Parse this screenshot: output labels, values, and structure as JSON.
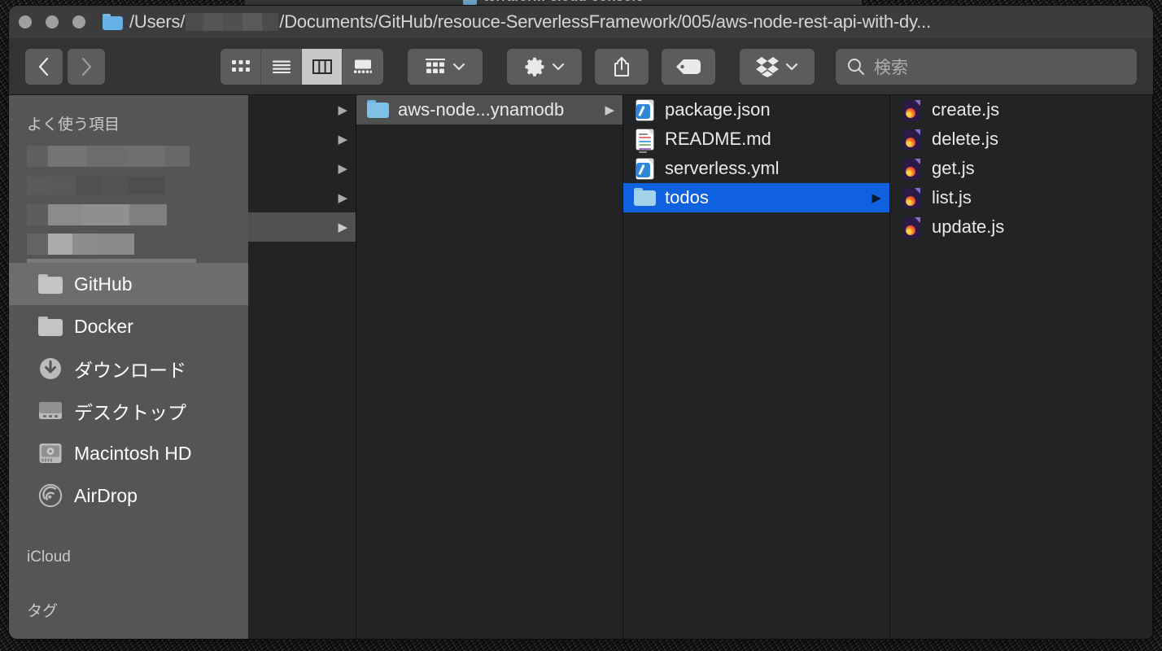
{
  "desktop": {
    "background_window": {
      "title": "terraform-cloud-console",
      "folder_icon": "folder-icon"
    }
  },
  "window": {
    "title_prefix": "/Users/",
    "title_suffix": "/Documents/GitHub/resouce-ServerlessFramework/005/aws-node-rest-api-with-dy...",
    "title_full": "/Users/[redacted]/Documents/GitHub/resouce-ServerlessFramework/005/aws-node-rest-api-with-dy...",
    "folder_icon": "folder-icon",
    "traffic_lights": {
      "close": "close-button",
      "minimize": "minimize-button",
      "zoom": "zoom-button"
    },
    "accent_blue": "#1061e0",
    "selection_gray": "#4e5051"
  },
  "toolbar": {
    "back_label": "‹",
    "forward_label": "›",
    "view_modes": [
      {
        "name": "icon-view",
        "label": "icon",
        "active": false
      },
      {
        "name": "list-view",
        "label": "list",
        "active": false
      },
      {
        "name": "column-view",
        "label": "column",
        "active": true
      },
      {
        "name": "gallery-view",
        "label": "gallery",
        "active": false
      }
    ],
    "group_by_label": "group-by",
    "action_label": "action-gear",
    "share_label": "share",
    "tags_label": "tags",
    "dropbox_label": "dropbox",
    "chevron": "⌄"
  },
  "search": {
    "placeholder": "検索",
    "value": "",
    "icon": "search-icon"
  },
  "sidebar": {
    "sections": [
      {
        "header": "よく使う項目",
        "items": [
          {
            "label": "",
            "icon": "redacted",
            "redacted": true,
            "selected": false
          },
          {
            "label": "",
            "icon": "redacted",
            "redacted": true,
            "selected": false
          },
          {
            "label": "",
            "icon": "redacted",
            "redacted": true,
            "selected": false
          },
          {
            "label": "",
            "icon": "redacted",
            "redacted": true,
            "selected": false
          },
          {
            "label": "GitHub",
            "icon": "folder-icon",
            "redacted": false,
            "selected": true
          },
          {
            "label": "Docker",
            "icon": "folder-icon",
            "redacted": false,
            "selected": false
          },
          {
            "label": "ダウンロード",
            "icon": "downloads-icon",
            "redacted": false,
            "selected": false
          },
          {
            "label": "デスクトップ",
            "icon": "desktop-icon",
            "redacted": false,
            "selected": false
          },
          {
            "label": "Macintosh HD",
            "icon": "harddisk-icon",
            "redacted": false,
            "selected": false
          },
          {
            "label": "AirDrop",
            "icon": "airdrop-icon",
            "redacted": false,
            "selected": false
          }
        ]
      },
      {
        "header": "iCloud",
        "items": []
      },
      {
        "header": "タグ",
        "items": []
      }
    ]
  },
  "columns": [
    {
      "name": "column-1",
      "items": [
        {
          "label": "",
          "icon": "redacted-folder",
          "has_arrow": true,
          "selected": false,
          "blank": true
        },
        {
          "label": "",
          "icon": "redacted-folder",
          "has_arrow": true,
          "selected": false,
          "blank": true
        },
        {
          "label": "",
          "icon": "redacted-folder",
          "has_arrow": true,
          "selected": false,
          "blank": true
        },
        {
          "label": "",
          "icon": "redacted-folder",
          "has_arrow": true,
          "selected": false,
          "blank": true
        },
        {
          "label": "",
          "icon": "redacted-folder",
          "has_arrow": true,
          "selected": "gray",
          "blank": true
        }
      ]
    },
    {
      "name": "column-2",
      "items": [
        {
          "label": "aws-node...ynamodb",
          "icon": "folder-icon",
          "has_arrow": true,
          "selected": "gray",
          "blank": false
        }
      ]
    },
    {
      "name": "column-3",
      "items": [
        {
          "label": "package.json",
          "icon": "document-icon",
          "has_arrow": false,
          "selected": false,
          "blank": false
        },
        {
          "label": "README.md",
          "icon": "markdown-icon",
          "has_arrow": false,
          "selected": false,
          "blank": false
        },
        {
          "label": "serverless.yml",
          "icon": "document-icon",
          "has_arrow": false,
          "selected": false,
          "blank": false
        },
        {
          "label": "todos",
          "icon": "folder-icon",
          "has_arrow": true,
          "selected": "blue",
          "blank": false
        }
      ]
    },
    {
      "name": "column-4",
      "items": [
        {
          "label": "create.js",
          "icon": "js-file-icon",
          "has_arrow": false,
          "selected": false,
          "blank": false
        },
        {
          "label": "delete.js",
          "icon": "js-file-icon",
          "has_arrow": false,
          "selected": false,
          "blank": false
        },
        {
          "label": "get.js",
          "icon": "js-file-icon",
          "has_arrow": false,
          "selected": false,
          "blank": false
        },
        {
          "label": "list.js",
          "icon": "js-file-icon",
          "has_arrow": false,
          "selected": false,
          "blank": false
        },
        {
          "label": "update.js",
          "icon": "js-file-icon",
          "has_arrow": false,
          "selected": false,
          "blank": false
        }
      ]
    }
  ]
}
